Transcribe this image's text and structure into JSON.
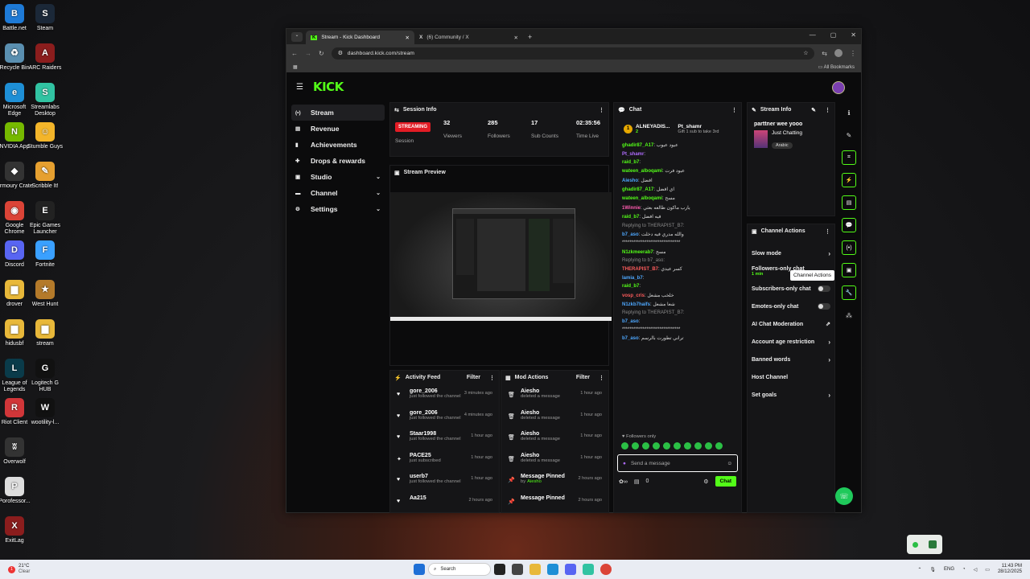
{
  "desktop": {
    "icons": [
      {
        "label": "Battle.net",
        "color": "#1e7ad6",
        "glyph": "B"
      },
      {
        "label": "Steam",
        "color": "#1b2838",
        "glyph": "S"
      },
      {
        "label": "Recycle Bin",
        "color": "#5a8fb0",
        "glyph": "♻"
      },
      {
        "label": "ARC Raiders",
        "color": "#8b1d1d",
        "glyph": "A"
      },
      {
        "label": "Microsoft Edge",
        "color": "#1e8fd6",
        "glyph": "e"
      },
      {
        "label": "Streamlabs Desktop",
        "color": "#31c3a2",
        "glyph": "S"
      },
      {
        "label": "NVIDIA App",
        "color": "#76b900",
        "glyph": "N"
      },
      {
        "label": "Stumble Guys",
        "color": "#f3b52a",
        "glyph": "☺"
      },
      {
        "label": "Armoury Crate",
        "color": "#333",
        "glyph": "◆"
      },
      {
        "label": "Scribble It!",
        "color": "#e6a030",
        "glyph": "✎"
      },
      {
        "label": "Google Chrome",
        "color": "#db4437",
        "glyph": "◉"
      },
      {
        "label": "Epic Games Launcher",
        "color": "#222",
        "glyph": "E"
      },
      {
        "label": "Discord",
        "color": "#5865f2",
        "glyph": "D"
      },
      {
        "label": "Fortnite",
        "color": "#3aa0ff",
        "glyph": "F"
      },
      {
        "label": "drover",
        "color": "#e8b83a",
        "glyph": "▆"
      },
      {
        "label": "West Hunt",
        "color": "#b47a2a",
        "glyph": "★"
      },
      {
        "label": "hidusbf",
        "color": "#e8b83a",
        "glyph": "▆"
      },
      {
        "label": "stream",
        "color": "#e8b83a",
        "glyph": "▆"
      },
      {
        "label": "League of Legends",
        "color": "#0a3b4a",
        "glyph": "L"
      },
      {
        "label": "Logitech G HUB",
        "color": "#111",
        "glyph": "G"
      },
      {
        "label": "Riot Client",
        "color": "#d13639",
        "glyph": "R"
      },
      {
        "label": "wootility-l...",
        "color": "#111",
        "glyph": "W"
      },
      {
        "label": "Overwolf",
        "color": "#333",
        "glyph": "ʬ"
      },
      {
        "label": "Porofessor...",
        "color": "#ddd",
        "glyph": "P"
      },
      {
        "label": "ExitLag",
        "color": "#8b1d1d",
        "glyph": "X"
      }
    ]
  },
  "browser": {
    "tabs": [
      {
        "title": "Stream - Kick Dashboard",
        "active": true
      },
      {
        "title": "(6) Community / X",
        "active": false
      }
    ],
    "url": "dashboard.kick.com/stream",
    "bookmarks_label": "All Bookmarks"
  },
  "app": {
    "logo": "KICK",
    "nav": [
      {
        "label": "Stream",
        "icon": "stream-icon",
        "glyph": "(•)",
        "active": true,
        "chevron": false
      },
      {
        "label": "Revenue",
        "icon": "revenue-icon",
        "glyph": "▤",
        "active": false,
        "chevron": false
      },
      {
        "label": "Achievements",
        "icon": "trophy-icon",
        "glyph": "▮",
        "active": false,
        "chevron": false
      },
      {
        "label": "Drops & rewards",
        "icon": "gift-icon",
        "glyph": "✚",
        "active": false,
        "chevron": false
      },
      {
        "label": "Studio",
        "icon": "studio-icon",
        "glyph": "▣",
        "active": false,
        "chevron": true
      },
      {
        "label": "Channel",
        "icon": "channel-icon",
        "glyph": "▬",
        "active": false,
        "chevron": true
      },
      {
        "label": "Settings",
        "icon": "gear-icon",
        "glyph": "⚙",
        "active": false,
        "chevron": true
      }
    ],
    "session": {
      "title": "Session Info",
      "status": "STREAMING",
      "status_label": "Session",
      "viewers": "32",
      "viewers_label": "Viewers",
      "followers": "285",
      "followers_label": "Followers",
      "subs": "17",
      "subs_label": "Sub Counts",
      "time": "02:35:56",
      "time_label": "Time Live"
    },
    "preview": {
      "title": "Stream Preview"
    },
    "activity": {
      "title": "Activity Feed",
      "filter": "Filter",
      "items": [
        {
          "name": "gore_2006",
          "desc": "just followed the channel",
          "time": "3 minutes ago",
          "glyph": "♥"
        },
        {
          "name": "gore_2006",
          "desc": "just followed the channel",
          "time": "4 minutes ago",
          "glyph": "♥"
        },
        {
          "name": "Staar1998",
          "desc": "just followed the channel",
          "time": "1 hour ago",
          "glyph": "♥"
        },
        {
          "name": "PACE25",
          "desc": "just subscribed",
          "time": "1 hour ago",
          "glyph": "✦"
        },
        {
          "name": "userb7",
          "desc": "just followed the channel",
          "time": "1 hour ago",
          "glyph": "♥"
        },
        {
          "name": "Aa215",
          "desc": "",
          "time": "2 hours ago",
          "glyph": "♥"
        }
      ]
    },
    "mod": {
      "title": "Mod Actions",
      "filter": "Filter",
      "items": [
        {
          "name": "Aiesho",
          "desc": "deleted a message",
          "by": "",
          "time": "1 hour ago",
          "glyph": "🗑"
        },
        {
          "name": "Aiesho",
          "desc": "deleted a message",
          "by": "",
          "time": "1 hour ago",
          "glyph": "🗑"
        },
        {
          "name": "Aiesho",
          "desc": "deleted a message",
          "by": "",
          "time": "1 hour ago",
          "glyph": "🗑"
        },
        {
          "name": "Aiesho",
          "desc": "deleted a message",
          "by": "",
          "time": "1 hour ago",
          "glyph": "🗑"
        },
        {
          "name": "Message Pinned",
          "desc": "by",
          "by": "Aiesho",
          "time": "2 hours ago",
          "glyph": "📌"
        },
        {
          "name": "Message Pinned",
          "desc": "",
          "by": "",
          "time": "2 hours ago",
          "glyph": "📌"
        }
      ]
    },
    "chat": {
      "title": "Chat",
      "pinned_user": "ALNEYADIS...",
      "pinned_count": "2",
      "gift_user": "Pt_shamr",
      "gift_text": "Gift 1 sub to take 3rd",
      "lines": [
        {
          "user": "ghadir87_A17",
          "color": "#53fc18",
          "text": "عيود عيوب",
          "reply": ""
        },
        {
          "user": "Pt_shamr",
          "color": "#b06cff",
          "text": "",
          "reply": ""
        },
        {
          "user": "raid_b7",
          "color": "#53fc18",
          "text": "",
          "reply": ""
        },
        {
          "user": "wateen_alboqami",
          "color": "#53fc18",
          "text": "عيود فرت",
          "reply": ""
        },
        {
          "user": "Aiesho",
          "color": "#4ea8ff",
          "text": "افضل",
          "reply": ""
        },
        {
          "user": "ghadir87_A17",
          "color": "#53fc18",
          "text": "اي افضل",
          "reply": ""
        },
        {
          "user": "wateen_alboqami",
          "color": "#53fc18",
          "text": "مسح",
          "reply": ""
        },
        {
          "user": "1Winnie",
          "color": "#ff5cb0",
          "text": "يارب ماكون طالعه بعثي",
          "reply": ""
        },
        {
          "user": "raid_b7",
          "color": "#53fc18",
          "text": "فيه افضل",
          "reply": ""
        },
        {
          "user": "b7_aso",
          "color": "#4ea8ff",
          "text": "والله مدري فيه دخلت",
          "reply": "Replying to THERAPIST_B7:"
        },
        {
          "user": "",
          "color": "#ddd",
          "text": "*******************************",
          "reply": ""
        },
        {
          "user": "N1zkmeerab7",
          "color": "#53fc18",
          "text": "مسح",
          "reply": ""
        },
        {
          "user": "THERAPIST_B7",
          "color": "#ff5c5c",
          "text": "كسر عيدي",
          "reply": "Replying to b7_aso:"
        },
        {
          "user": "lamia_b7",
          "color": "#4ea8ff",
          "text": "",
          "reply": ""
        },
        {
          "user": "raid_b7",
          "color": "#53fc18",
          "text": "",
          "reply": ""
        },
        {
          "user": "vosp_cris",
          "color": "#ff5c5c",
          "text": "خلخب مشعل",
          "reply": ""
        },
        {
          "user": "N1zkb7haifs",
          "color": "#4ea8ff",
          "text": "شعا مشعل",
          "reply": ""
        },
        {
          "user": "b7_aso",
          "color": "#4ea8ff",
          "text": "",
          "reply": "Replying to THERAPIST_B7:"
        },
        {
          "user": "",
          "color": "#ddd",
          "text": "*******************************",
          "reply": ""
        },
        {
          "user": "b7_aso",
          "color": "#4ea8ff",
          "text": "تراني تطورت بالرسم",
          "reply": ""
        }
      ],
      "followers_only": "Followers only",
      "placeholder": "Send a message",
      "count": "0",
      "send": "Chat"
    },
    "stream_info": {
      "title": "Stream Info",
      "stream_title": "parttner wee yooo",
      "category": "Just Chatting",
      "tag": "Arabic"
    },
    "channel_actions": {
      "title": "Channel Actions",
      "tooltip": "Channel Actions",
      "items": [
        {
          "label": "Slow mode",
          "kind": "chevron",
          "sub": ""
        },
        {
          "label": "Followers-only chat",
          "kind": "none",
          "sub": "1 min"
        },
        {
          "label": "Subscribers-only chat",
          "kind": "toggle",
          "sub": ""
        },
        {
          "label": "Emotes-only chat",
          "kind": "toggle",
          "sub": ""
        },
        {
          "label": "AI Chat Moderation",
          "kind": "link",
          "sub": ""
        },
        {
          "label": "Account age restriction",
          "kind": "chevron",
          "sub": ""
        },
        {
          "label": "Banned words",
          "kind": "chevron",
          "sub": ""
        },
        {
          "label": "Host Channel",
          "kind": "none",
          "sub": ""
        },
        {
          "label": "Set goals",
          "kind": "chevron",
          "sub": ""
        }
      ]
    }
  },
  "taskbar": {
    "weather_temp": "21°C",
    "weather_desc": "Clear",
    "search": "Search",
    "lang": "ENG",
    "time": "11:43 PM",
    "date": "28/12/2025"
  }
}
